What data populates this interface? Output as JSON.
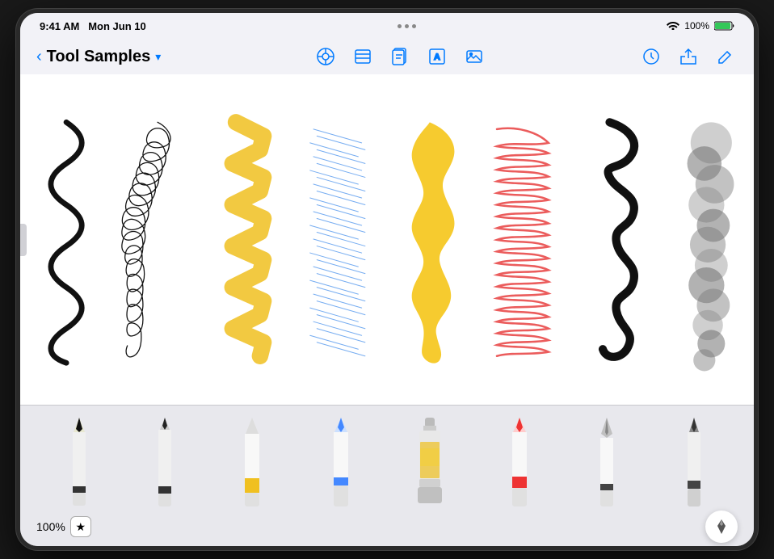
{
  "status_bar": {
    "time": "9:41 AM",
    "date": "Mon Jun 10",
    "battery": "100%",
    "wifi": true
  },
  "nav": {
    "back_label": "Back",
    "title": "Tool Samples",
    "dropdown_indicator": "▾",
    "center_icons": [
      "draw-icon",
      "layers-icon",
      "pages-icon",
      "text-icon",
      "media-icon"
    ],
    "right_icons": [
      "history-icon",
      "share-icon",
      "edit-icon"
    ]
  },
  "canvas": {
    "background": "#ffffff"
  },
  "tools": {
    "zoom": "100%",
    "favorite_label": "★",
    "items": [
      {
        "name": "black-pencil",
        "color": "#000000",
        "band": "#333"
      },
      {
        "name": "fineliner",
        "color": "#000000",
        "band": "#333"
      },
      {
        "name": "yellow-marker",
        "color": "#f0c020",
        "band": "#f0c020"
      },
      {
        "name": "blue-marker",
        "color": "#4488ff",
        "band": "#4488ff"
      },
      {
        "name": "paint-bucket",
        "color": "#f0c020",
        "band": "#f0c020"
      },
      {
        "name": "red-crayon",
        "color": "#ee3333",
        "band": "#ee3333"
      },
      {
        "name": "fountain-pen",
        "color": "#333333",
        "band": "#333"
      },
      {
        "name": "dark-marker",
        "color": "#333333",
        "band": "#333"
      }
    ]
  }
}
